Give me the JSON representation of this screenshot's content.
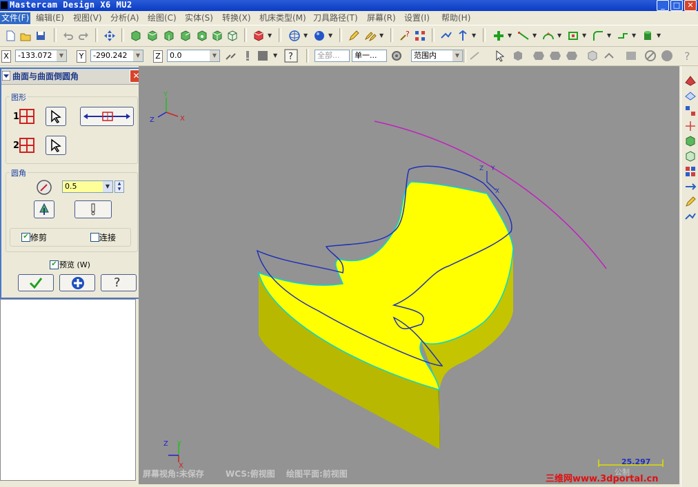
{
  "window": {
    "title": "Mastercam Design X6 MU2",
    "min_btn": "_",
    "max_btn": "□",
    "close_btn": "✕"
  },
  "menubar": {
    "items": [
      {
        "label": "文件(F)",
        "active": true
      },
      {
        "label": "编辑(E)"
      },
      {
        "label": "视图(V)"
      },
      {
        "label": "分析(A)"
      },
      {
        "label": "绘图(C)"
      },
      {
        "label": "实体(S)"
      },
      {
        "label": "转换(X)"
      },
      {
        "label": "机床类型(M)"
      },
      {
        "label": "刀具路径(T)"
      },
      {
        "label": "屏幕(R)"
      },
      {
        "label": "设置(I)"
      },
      {
        "label": "帮助(H)"
      }
    ]
  },
  "coords": {
    "x_label": "X",
    "x_value": "-133.072",
    "y_label": "Y",
    "y_value": "-290.242",
    "z_label": "Z",
    "z_value": "0.0"
  },
  "selection": {
    "all_label": "全部...",
    "single_label": "单一...",
    "range_value": "范围内"
  },
  "dialog": {
    "title": "曲面与曲面倒圆角",
    "geometry_group": "图形",
    "entity1_num": "1",
    "entity2_num": "2",
    "fillet_group": "圆角",
    "radius_value": "0.5",
    "trim_label": "修剪",
    "trim_checked": true,
    "connect_label": "连接",
    "connect_checked": false,
    "preview_label": "预览 (W)",
    "preview_checked": true,
    "ok_icon": "checkmark-icon",
    "apply_icon": "plus-icon",
    "help_icon": "question-icon"
  },
  "viewport": {
    "background": "#939393",
    "part_color": "#ffff00",
    "status_screen_view": "屏幕视角:未保存",
    "status_wcs": "WCS:俯视图",
    "status_plane": "绘图平面:前视图",
    "scale_value": "25.297",
    "scale_unit": "公制",
    "watermark": "三维网www.3dportal.cn",
    "axis_x": "X",
    "axis_y": "Y",
    "axis_z": "Z"
  },
  "colors": {
    "accent_blue": "#316ac5",
    "toolpath_blue": "#1f2fb8",
    "arc_magenta": "#c020c0",
    "part_yellow": "#ffff00",
    "watermark_red": "#e01010"
  }
}
